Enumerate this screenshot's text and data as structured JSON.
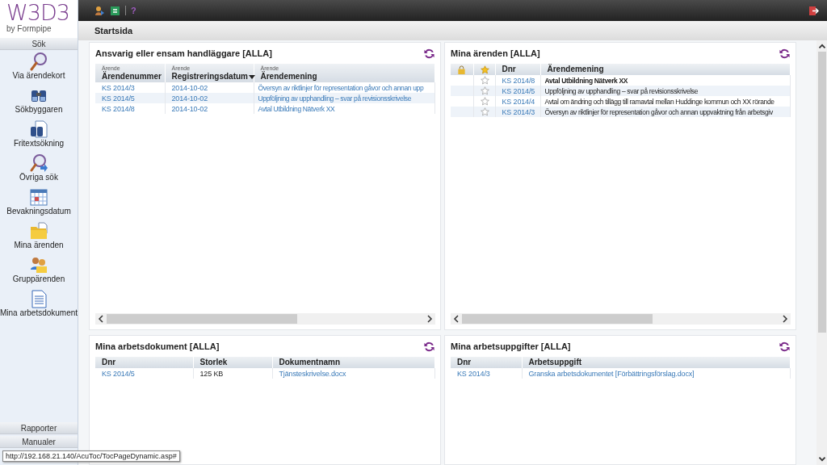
{
  "sidebar": {
    "logo": "W3D3",
    "tagline": "by Formpipe",
    "section": "Sök",
    "items": [
      {
        "label": "Via ärendekort"
      },
      {
        "label": "Sökbyggaren"
      },
      {
        "label": "Fritextsökning"
      },
      {
        "label": "Övriga sök"
      },
      {
        "label": "Bevakningsdatum"
      },
      {
        "label": "Mina ärenden"
      },
      {
        "label": "Gruppärenden"
      },
      {
        "label": "Mina arbetsdokument"
      }
    ],
    "bottom_sections": [
      "Rapporter",
      "Manualer"
    ]
  },
  "toolbar": {
    "help": "?"
  },
  "page_title": "Startsida",
  "panels": [
    {
      "title": "Ansvarig eller ensam handläggare [ALLA]",
      "kind": "cases",
      "scrollbar": true,
      "columns": [
        {
          "group": "Ärende",
          "label": "Ärendenummer",
          "sorted": false
        },
        {
          "group": "Ärende",
          "label": "Registreringsdatum",
          "sorted": true
        },
        {
          "group": "Ärende",
          "label": "Ärendemening",
          "sorted": false
        }
      ],
      "rows": [
        {
          "cells": [
            "KS 2014/3",
            "2014-10-02",
            "Översyn av riktlinjer för representation gåvor och annan upp"
          ]
        },
        {
          "cells": [
            "KS 2014/5",
            "2014-10-02",
            "Uppföljning av upphandling – svar på revisionsskrivelse"
          ]
        },
        {
          "cells": [
            "KS 2014/8",
            "2014-10-02",
            "Avtal Utbildning Nätverk XX"
          ]
        }
      ]
    },
    {
      "title": "Mina ärenden [ALLA]",
      "kind": "my_cases",
      "scrollbar": true,
      "columns": [
        {
          "label": "Dnr"
        },
        {
          "label": "Ärendemening"
        }
      ],
      "rows": [
        {
          "starred": false,
          "unread": true,
          "cells": [
            "KS 2014/8",
            "Avtal Utbildning Nätverk XX"
          ]
        },
        {
          "starred": false,
          "unread": false,
          "cells": [
            "KS 2014/5",
            "Uppföljning av upphandling – svar på revisionsskrivelse"
          ]
        },
        {
          "starred": false,
          "unread": false,
          "cells": [
            "KS 2014/4",
            "Avtal om ändring och tillägg till ramavtal mellan Huddinge kommun och XX rörande"
          ]
        },
        {
          "starred": false,
          "unread": false,
          "cells": [
            "KS 2014/3",
            "Översyn av riktlinjer för representation gåvor och annan uppvaktning från arbetsgiv"
          ]
        }
      ]
    },
    {
      "title": "Mina arbetsdokument [ALLA]",
      "kind": "documents",
      "scrollbar": false,
      "columns": [
        {
          "label": "Dnr"
        },
        {
          "label": "Storlek"
        },
        {
          "label": "Dokumentnamn"
        }
      ],
      "rows": [
        {
          "cells": [
            "KS 2014/5",
            "125 KB",
            "Tjänsteskrivelse.docx"
          ]
        }
      ]
    },
    {
      "title": "Mina arbetsuppgifter [ALLA]",
      "kind": "tasks",
      "scrollbar": false,
      "columns": [
        {
          "label": "Dnr"
        },
        {
          "label": "Arbetsuppgift"
        }
      ],
      "rows": [
        {
          "cells": [
            "KS 2014/3",
            "Granska arbetsdokumentet [Förbättringsförslag.docx]"
          ]
        }
      ]
    }
  ],
  "status_url": "http://192.168.21.140/AcuToc/TocPageDynamic.asp#"
}
